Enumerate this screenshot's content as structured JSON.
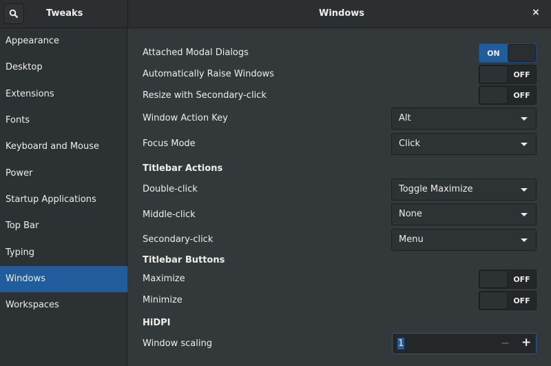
{
  "header": {
    "app_title": "Tweaks",
    "page_title": "Windows",
    "close": "×"
  },
  "sidebar": {
    "items": [
      {
        "label": "Appearance"
      },
      {
        "label": "Desktop"
      },
      {
        "label": "Extensions"
      },
      {
        "label": "Fonts"
      },
      {
        "label": "Keyboard and Mouse"
      },
      {
        "label": "Power"
      },
      {
        "label": "Startup Applications"
      },
      {
        "label": "Top Bar"
      },
      {
        "label": "Typing"
      },
      {
        "label": "Windows",
        "selected": true
      },
      {
        "label": "Workspaces"
      }
    ]
  },
  "main": {
    "attached_modal": {
      "label": "Attached Modal Dialogs",
      "state": "ON"
    },
    "auto_raise": {
      "label": "Automatically Raise Windows",
      "state": "OFF"
    },
    "resize_secondary": {
      "label": "Resize with Secondary-click",
      "state": "OFF"
    },
    "action_key": {
      "label": "Window Action Key",
      "value": "Alt"
    },
    "focus_mode": {
      "label": "Focus Mode",
      "value": "Click"
    },
    "titlebar_actions": "Titlebar Actions",
    "double_click": {
      "label": "Double-click",
      "value": "Toggle Maximize"
    },
    "middle_click": {
      "label": "Middle-click",
      "value": "None"
    },
    "secondary_click": {
      "label": "Secondary-click",
      "value": "Menu"
    },
    "titlebar_buttons": "Titlebar Buttons",
    "maximize": {
      "label": "Maximize",
      "state": "OFF"
    },
    "minimize": {
      "label": "Minimize",
      "state": "OFF"
    },
    "hidpi": "HiDPI",
    "scaling": {
      "label": "Window scaling",
      "value": "1",
      "minus": "−",
      "plus": "+"
    }
  },
  "colors": {
    "accent": "#215d9c",
    "background": "#33393b",
    "sidebar": "#2c3133"
  }
}
